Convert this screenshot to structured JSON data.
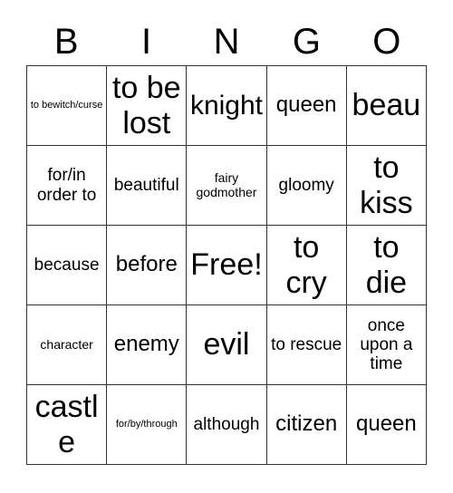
{
  "card": {
    "title": "BINGO",
    "headers": [
      "B",
      "I",
      "N",
      "G",
      "O"
    ],
    "free_space_label": "Free!",
    "colors": {
      "background": "#ffffff",
      "text": "#000000",
      "border": "#333333"
    },
    "rows": [
      [
        {
          "text": "to bewitch/curse",
          "size": "fs-xs"
        },
        {
          "text": "to be lost",
          "size": "fs-xxl"
        },
        {
          "text": "knight",
          "size": "fs-xl"
        },
        {
          "text": "queen",
          "size": "fs-lg"
        },
        {
          "text": "beau",
          "size": "fs-xxl"
        }
      ],
      [
        {
          "text": "for/in order to",
          "size": "fs-md"
        },
        {
          "text": "beautiful",
          "size": "fs-md"
        },
        {
          "text": "fairy godmother",
          "size": "fs-sm"
        },
        {
          "text": "gloomy",
          "size": "fs-md"
        },
        {
          "text": "to kiss",
          "size": "fs-xxl"
        }
      ],
      [
        {
          "text": "because",
          "size": "fs-md"
        },
        {
          "text": "before",
          "size": "fs-lg"
        },
        {
          "text": "Free!",
          "size": "fs-xxl"
        },
        {
          "text": "to cry",
          "size": "fs-xxl"
        },
        {
          "text": "to die",
          "size": "fs-xxl"
        }
      ],
      [
        {
          "text": "character",
          "size": "fs-sm"
        },
        {
          "text": "enemy",
          "size": "fs-lg"
        },
        {
          "text": "evil",
          "size": "fs-xxl"
        },
        {
          "text": "to rescue",
          "size": "fs-md"
        },
        {
          "text": "once upon a time",
          "size": "fs-md"
        }
      ],
      [
        {
          "text": "castle",
          "size": "fs-xxl"
        },
        {
          "text": "for/by/through",
          "size": "fs-xs"
        },
        {
          "text": "although",
          "size": "fs-md"
        },
        {
          "text": "citizen",
          "size": "fs-lg"
        },
        {
          "text": "queen",
          "size": "fs-lg"
        }
      ]
    ]
  }
}
